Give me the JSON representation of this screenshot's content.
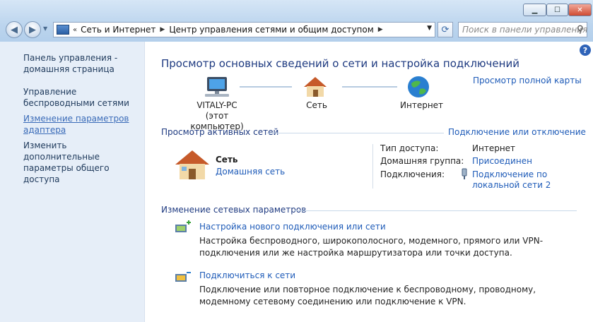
{
  "window": {
    "minimize_icon": "minimize-icon",
    "maximize_icon": "maximize-icon",
    "close_icon": "close-icon"
  },
  "nav": {
    "back_icon": "back-arrow-icon",
    "forward_icon": "forward-arrow-icon"
  },
  "address": {
    "breadcrumb": [
      "Сеть и Интернет",
      "Центр управления сетями и общим доступом"
    ]
  },
  "search": {
    "placeholder": "Поиск в панели управления"
  },
  "sidebar": {
    "home": "Панель управления - домашняя страница",
    "wireless": "Управление беспроводными сетями",
    "adapter": "Изменение параметров адаптера",
    "sharing": "Изменить дополнительные параметры общего доступа"
  },
  "main": {
    "help": "?",
    "title": "Просмотр основных сведений о сети и настройка подключений",
    "full_map": "Просмотр полной карты",
    "map": {
      "pc_name": "VITALY-PC",
      "pc_sub": "(этот компьютер)",
      "network": "Сеть",
      "internet": "Интернет"
    },
    "active_title": "Просмотр активных сетей",
    "connect_toggle": "Подключение или отключение",
    "active_network": {
      "name": "Сеть",
      "type": "Домашняя сеть",
      "props": [
        {
          "label": "Тип доступа:",
          "value": "Интернет"
        },
        {
          "label": "Домашняя группа:",
          "value": "Присоединен"
        },
        {
          "label": "Подключения:",
          "value": "Подключение по локальной сети 2"
        }
      ]
    },
    "change_title": "Изменение сетевых параметров",
    "tasks": [
      {
        "title": "Настройка нового подключения или сети",
        "desc": "Настройка беспроводного, широкополосного, модемного, прямого или VPN-подключения или же настройка маршрутизатора или точки доступа."
      },
      {
        "title": "Подключиться к сети",
        "desc": "Подключение или повторное подключение к беспроводному, проводному, модемному сетевому соединению или подключение к VPN."
      }
    ]
  },
  "colors": {
    "link": "#1e5bb8",
    "heading": "#1e3a80",
    "sidebar_bg": "#e6eef8"
  }
}
